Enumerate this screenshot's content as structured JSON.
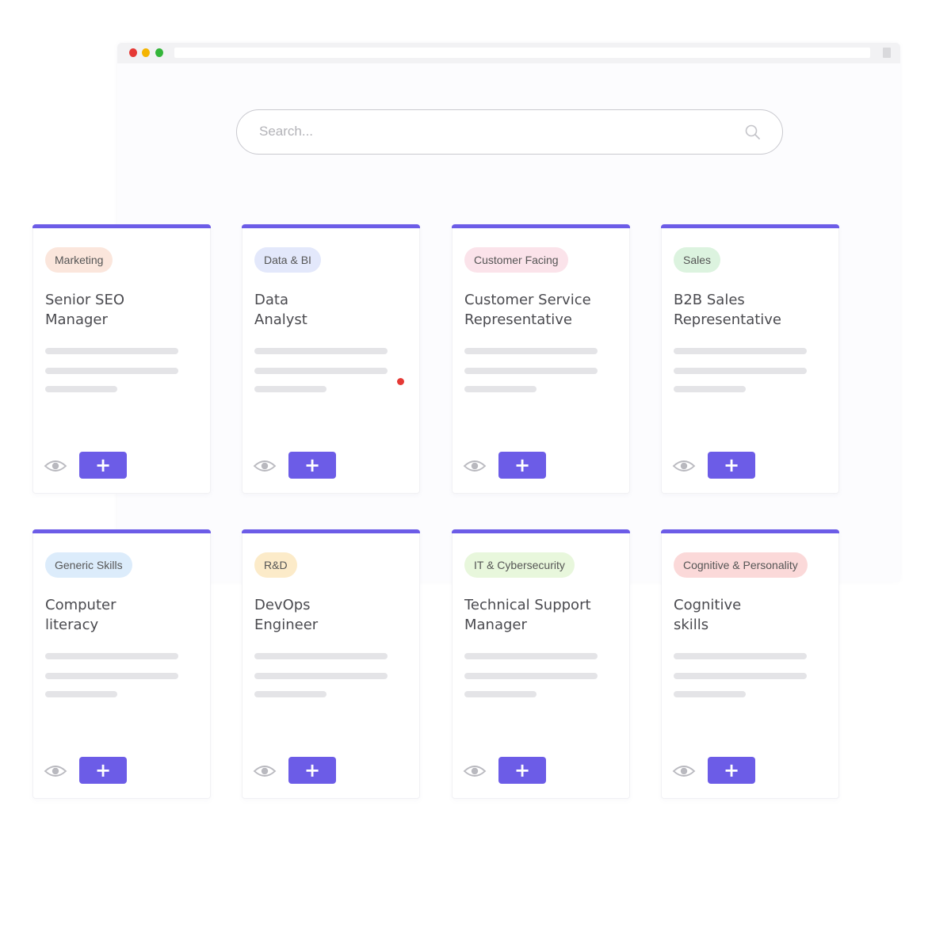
{
  "window": {
    "controls": [
      "close",
      "minimize",
      "maximize"
    ]
  },
  "search": {
    "placeholder": "Search...",
    "value": "",
    "icon": "search-icon"
  },
  "colors": {
    "accent": "#6c5ce7",
    "close": "#e53935",
    "minimize": "#f4b400",
    "maximize": "#34b53a"
  },
  "cards": [
    {
      "tag": "Marketing",
      "tag_color": "#fbe6dc",
      "title_line1": "Senior SEO",
      "title_line2": "Manager",
      "add_label": "+"
    },
    {
      "tag": "Data & BI",
      "tag_color": "#e3e8fb",
      "title_line1": "Data",
      "title_line2": "Analyst",
      "add_label": "+"
    },
    {
      "tag": "Customer Facing",
      "tag_color": "#fbe3ea",
      "title_line1": "Customer Service",
      "title_line2": "Representative",
      "add_label": "+"
    },
    {
      "tag": "Sales",
      "tag_color": "#dcf3df",
      "title_line1": "B2B Sales",
      "title_line2": "Representative",
      "add_label": "+"
    },
    {
      "tag": "Generic Skills",
      "tag_color": "#dcecfb",
      "title_line1": "Computer",
      "title_line2": "literacy",
      "add_label": "+"
    },
    {
      "tag": "R&D",
      "tag_color": "#fcebc9",
      "title_line1": "DevOps",
      "title_line2": "Engineer",
      "add_label": "+"
    },
    {
      "tag": "IT & Cybersecurity",
      "tag_color": "#e8f7dc",
      "title_line1": "Technical Support",
      "title_line2": "Manager",
      "add_label": "+"
    },
    {
      "tag": "Cognitive & Personality",
      "tag_color": "#fbd9d9",
      "title_line1": "Cognitive",
      "title_line2": "skills",
      "add_label": "+"
    }
  ]
}
